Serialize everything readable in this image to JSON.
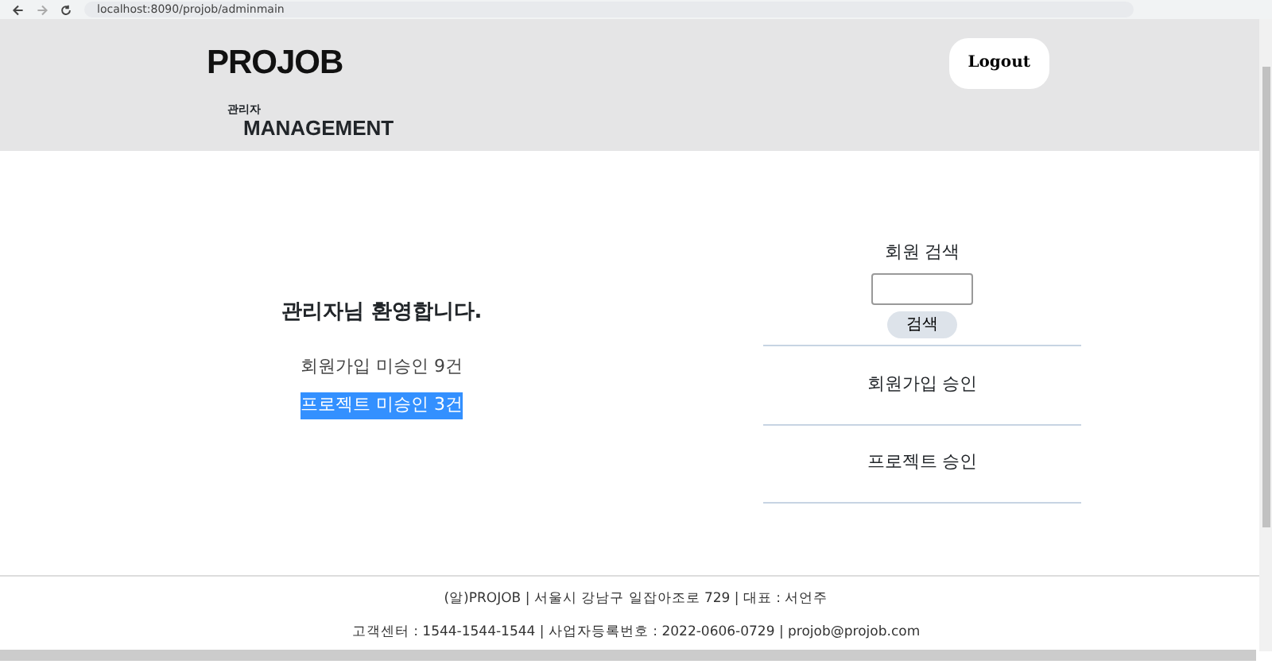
{
  "browser": {
    "url": "localhost:8090/projob/adminmain"
  },
  "header": {
    "logo": "PROJOB",
    "sub_label": "관리자",
    "sub_title": "MANAGEMENT",
    "logout": "Logout"
  },
  "welcome": {
    "title": "관리자님 환영합니다.",
    "notices": [
      {
        "text": "회원가입 미승인 9건",
        "highlighted": false
      },
      {
        "text": "프로젝트 미승인 3건",
        "highlighted": true
      }
    ]
  },
  "search": {
    "label": "회원 검색",
    "button": "검색"
  },
  "menu": [
    "회원가입 승인",
    "프로젝트 승인"
  ],
  "footer": [
    "(알)PROJOB | 서울시 강남구 일잡아조로 729 | 대표 : 서언주",
    "고객센터 : 1544-1544-1544 | 사업자등록번호 : 2022-0606-0729 | projob@projob.com"
  ]
}
